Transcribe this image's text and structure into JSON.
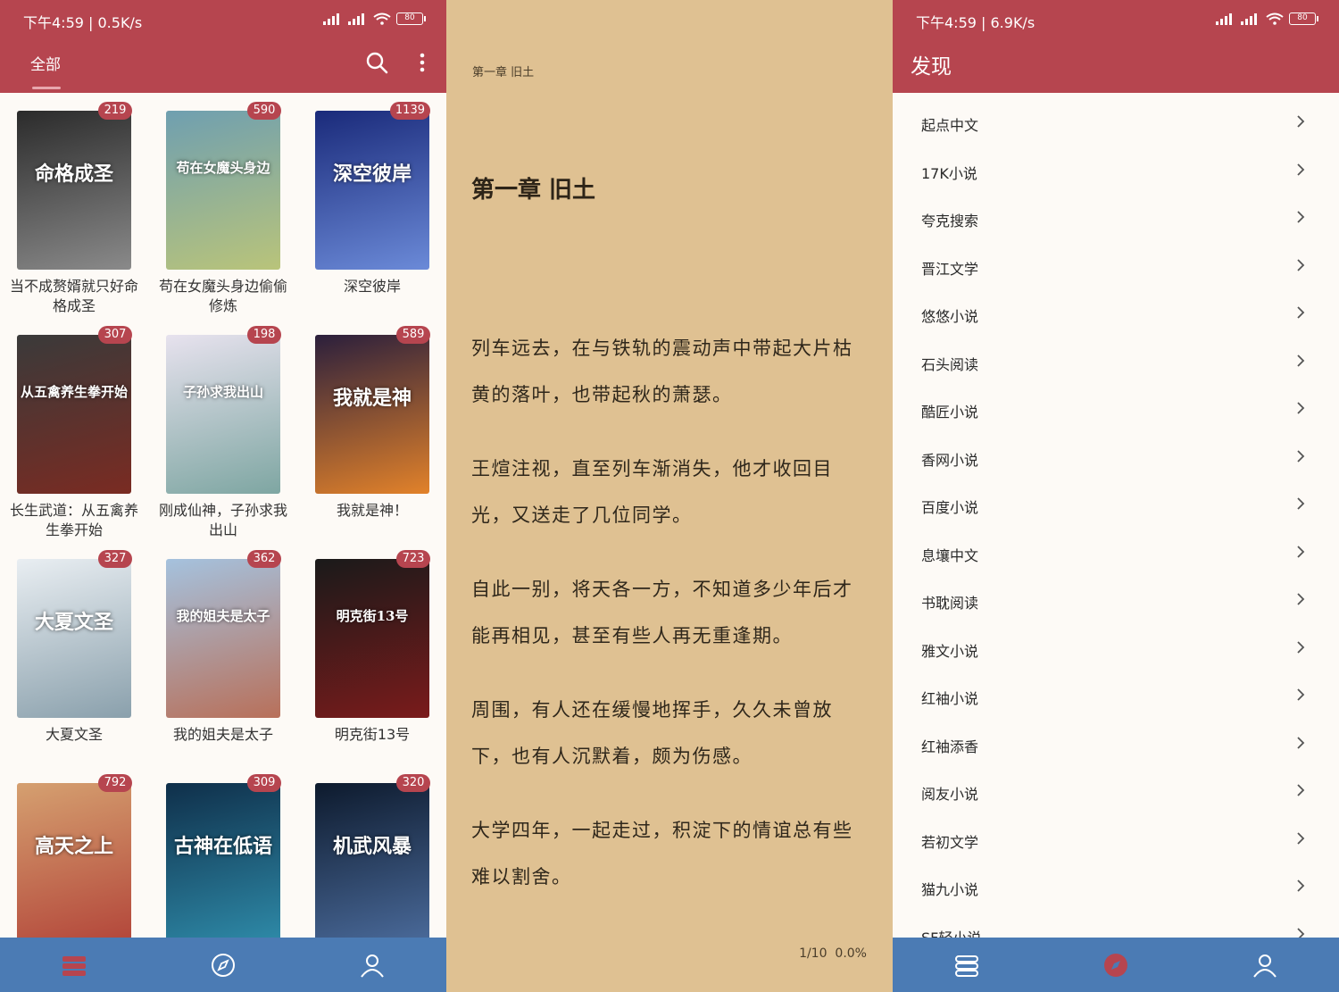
{
  "colors": {
    "primary": "#b6454f",
    "nav": "#4b7bb4",
    "reader_bg": "#dfc192",
    "page_bg": "#fdfaf6"
  },
  "bookshelf": {
    "status_time": "下午4:59 | 0.5K/s",
    "battery": "80",
    "tab_label": "全部",
    "books": [
      {
        "title": "当不成赘婿就只好命格成圣",
        "count": "219",
        "cover_text": "命格成圣",
        "colors": [
          "#2b2b2b",
          "#8a8a8a"
        ]
      },
      {
        "title": "苟在女魔头身边偷偷修炼",
        "count": "590",
        "cover_text": "苟在女魔头身边",
        "colors": [
          "#6f9fb0",
          "#b9c47a"
        ]
      },
      {
        "title": "深空彼岸",
        "count": "1139",
        "cover_text": "深空彼岸",
        "colors": [
          "#1a2a7a",
          "#6b8ad8"
        ]
      },
      {
        "title": "长生武道：从五禽养生拳开始",
        "count": "307",
        "cover_text": "从五禽养生拳开始",
        "colors": [
          "#3a3a3a",
          "#7a2b22"
        ]
      },
      {
        "title": "刚成仙神，子孙求我出山",
        "count": "198",
        "cover_text": "子孙求我出山",
        "colors": [
          "#e7e2ee",
          "#7ea6a2"
        ]
      },
      {
        "title": "我就是神！",
        "count": "589",
        "cover_text": "我就是神",
        "colors": [
          "#2b1f3c",
          "#e2822a"
        ]
      },
      {
        "title": "大夏文圣",
        "count": "327",
        "cover_text": "大夏文圣",
        "colors": [
          "#e9eef2",
          "#8aa0ac"
        ]
      },
      {
        "title": "我的姐夫是太子",
        "count": "362",
        "cover_text": "我的姐夫是太子",
        "colors": [
          "#a5c2de",
          "#b8705a"
        ]
      },
      {
        "title": "明克街13号",
        "count": "723",
        "cover_text": "明克街13号",
        "colors": [
          "#1a1a1a",
          "#7a1b1b"
        ]
      },
      {
        "title": "",
        "count": "792",
        "cover_text": "高天之上",
        "colors": [
          "#d5a070",
          "#b3463a"
        ]
      },
      {
        "title": "",
        "count": "309",
        "cover_text": "古神在低语",
        "colors": [
          "#0f2f4a",
          "#2e8aa8"
        ]
      },
      {
        "title": "",
        "count": "320",
        "cover_text": "机武风暴",
        "colors": [
          "#0d1a2d",
          "#4a6a9a"
        ]
      }
    ]
  },
  "reader": {
    "header": "第一章 旧土",
    "chapter_title": "第一章 旧土",
    "paragraphs": [
      "列车远去，在与铁轨的震动声中带起大片枯黄的落叶，也带起秋的萧瑟。",
      "王煊注视，直至列车渐消失，他才收回目光，又送走了几位同学。",
      "自此一别，将天各一方，不知道多少年后才能再相见，甚至有些人再无重逢期。",
      "周围，有人还在缓慢地挥手，久久未曾放下，也有人沉默着，颇为伤感。",
      "大学四年，一起走过，积淀下的情谊总有些难以割舍。"
    ],
    "page_info": "1/10",
    "progress": "0.0%"
  },
  "discover": {
    "status_time": "下午4:59 | 6.9K/s",
    "battery": "80",
    "title": "发现",
    "sources": [
      "起点中文",
      "17K小说",
      "夸克搜索",
      "晋江文学",
      "悠悠小说",
      "石头阅读",
      "酷匠小说",
      "香网小说",
      "百度小说",
      "息壤中文",
      "书耽阅读",
      "雅文小说",
      "红袖小说",
      "红袖添香",
      "阅友小说",
      "若初文学",
      "猫九小说",
      "SF轻小说"
    ]
  }
}
